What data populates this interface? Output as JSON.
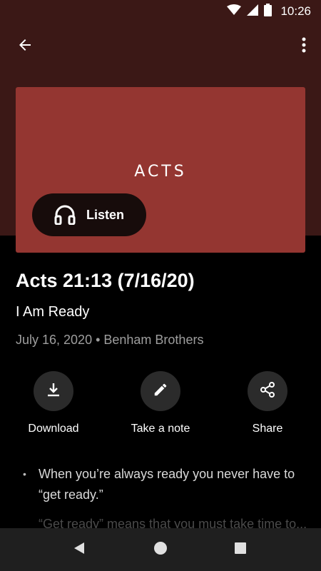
{
  "status_bar": {
    "time": "10:26",
    "icons": [
      "wifi-icon",
      "cell-signal-icon",
      "battery-icon"
    ]
  },
  "toolbar": {
    "back_icon": "arrow-left-icon",
    "more_icon": "more-vert-icon"
  },
  "cover": {
    "title": "ACTS",
    "background_color": "#943631",
    "listen_button": {
      "icon": "headphones-icon",
      "label": "Listen"
    }
  },
  "devotional": {
    "title": "Acts 21:13 (7/16/20)",
    "subtitle": "I Am Ready",
    "meta": "July 16, 2020 • Benham Brothers"
  },
  "actions": [
    {
      "icon": "download-icon",
      "label": "Download"
    },
    {
      "icon": "pencil-icon",
      "label": "Take a note"
    },
    {
      "icon": "share-icon",
      "label": "Share"
    }
  ],
  "notes": [
    {
      "text": "When you’re always ready you never have to “get ready.”"
    },
    {
      "text": "“Get ready” means that you must take time to..."
    }
  ],
  "nav_bar": {
    "icons": [
      "back-triangle-icon",
      "home-circle-icon",
      "recents-square-icon"
    ]
  },
  "colors": {
    "hero_background": "#3b1816",
    "accent_cover": "#943631",
    "listen_button_bg": "#170c0b",
    "page_background": "#000000"
  }
}
